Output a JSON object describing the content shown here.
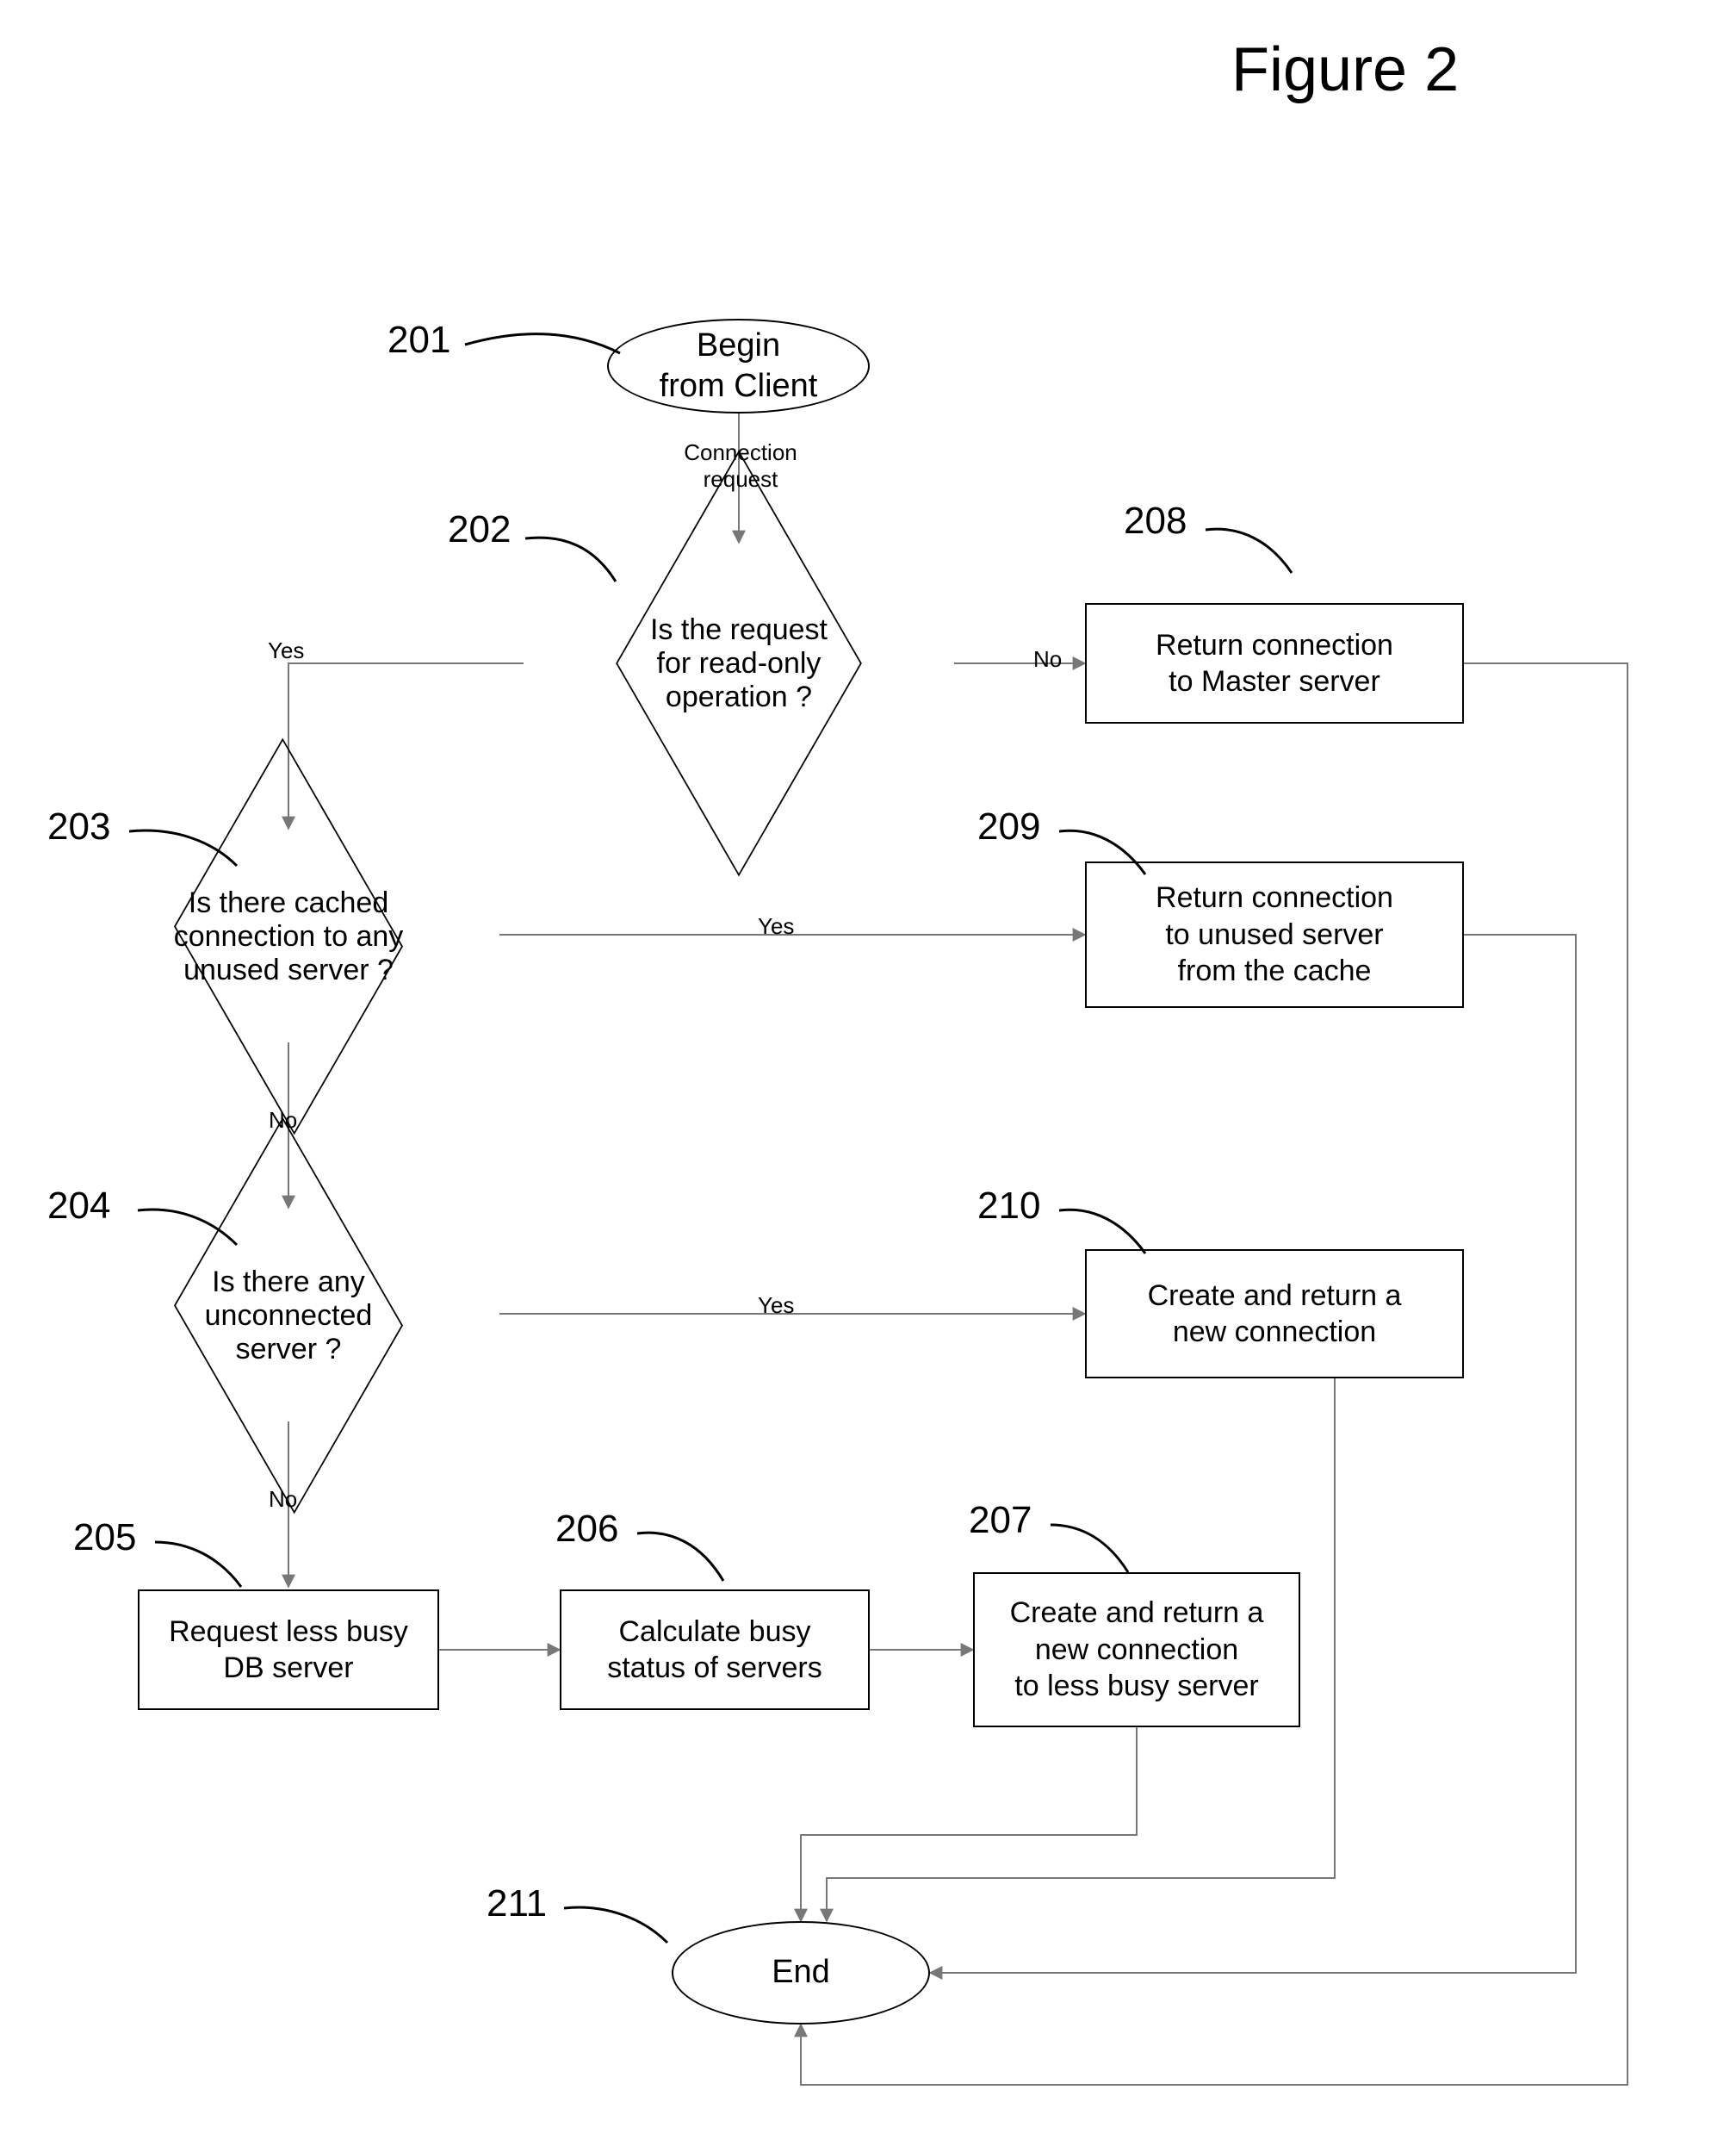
{
  "title": "Figure 2",
  "refs": {
    "r201": "201",
    "r202": "202",
    "r203": "203",
    "r204": "204",
    "r205": "205",
    "r206": "206",
    "r207": "207",
    "r208": "208",
    "r209": "209",
    "r210": "210",
    "r211": "211"
  },
  "nodes": {
    "n201": "Begin\nfrom Client",
    "n202": "Is the request\nfor read-only\noperation ?",
    "n203": "Is there cached\nconnection to any\nunused server ?",
    "n204": "Is there any\nunconnected\nserver ?",
    "n205": "Request less busy\nDB server",
    "n206": "Calculate busy\nstatus of servers",
    "n207": "Create and return a\nnew connection\nto less busy server",
    "n208": "Return connection\nto Master server",
    "n209": "Return connection\nto unused server\nfrom the cache",
    "n210": "Create and return a\nnew connection",
    "n211": "End"
  },
  "edges": {
    "e_conn_req": "Connection\nrequest",
    "e202_yes": "Yes",
    "e202_no": "No",
    "e203_yes": "Yes",
    "e203_no": "No",
    "e204_yes": "Yes",
    "e204_no": "No"
  }
}
